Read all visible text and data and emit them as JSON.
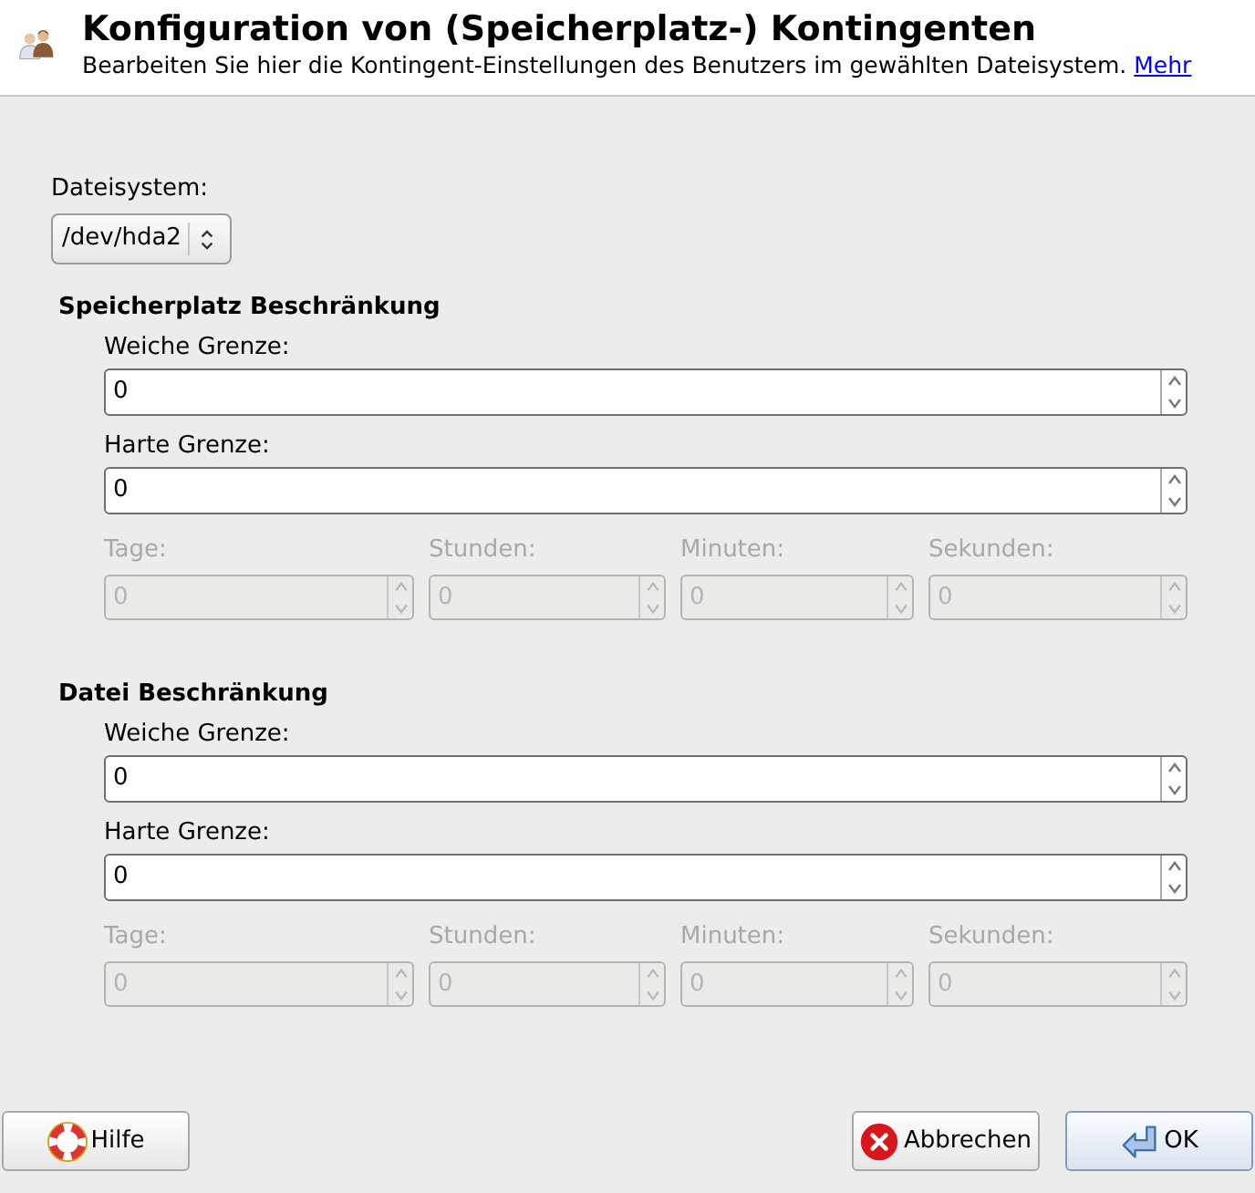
{
  "header": {
    "title": "Konfiguration von (Speicherplatz-) Kontingenten",
    "description": "Bearbeiten Sie hier die Kontingent-Einstellungen des Benutzers im gewählten Dateisystem.",
    "link": "Mehr"
  },
  "filesystem": {
    "label": "Dateisystem:",
    "value": "/dev/hda2"
  },
  "sections": [
    {
      "title": "Speicherplatz Beschränkung",
      "soft": {
        "label": "Weiche Grenze:",
        "value": "0"
      },
      "hard": {
        "label": "Harte Grenze:",
        "value": "0"
      },
      "grace": [
        {
          "label": "Tage:",
          "value": "0",
          "disabled": true
        },
        {
          "label": "Stunden:",
          "value": "0",
          "disabled": true
        },
        {
          "label": "Minuten:",
          "value": "0",
          "disabled": true
        },
        {
          "label": "Sekunden:",
          "value": "0",
          "disabled": true
        }
      ]
    },
    {
      "title": "Datei Beschränkung",
      "soft": {
        "label": "Weiche Grenze:",
        "value": "0"
      },
      "hard": {
        "label": "Harte Grenze:",
        "value": "0"
      },
      "grace": [
        {
          "label": "Tage:",
          "value": "0",
          "disabled": true
        },
        {
          "label": "Stunden:",
          "value": "0",
          "disabled": true
        },
        {
          "label": "Minuten:",
          "value": "0",
          "disabled": true
        },
        {
          "label": "Sekunden:",
          "value": "0",
          "disabled": true
        }
      ]
    }
  ],
  "buttons": [
    {
      "label": "Hilfe",
      "kind": "help",
      "default": false
    },
    {
      "label": "Abbrechen",
      "kind": "cancel",
      "default": false
    },
    {
      "label": "OK",
      "kind": "ok",
      "default": true
    }
  ]
}
